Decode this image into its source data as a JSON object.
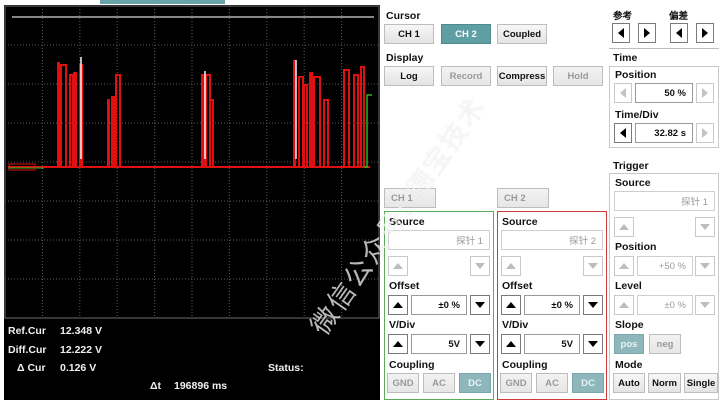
{
  "scope": {
    "readouts": {
      "ref_label": "Ref.Cur",
      "ref_value": "12.348 V",
      "diff_label": "Diff.Cur",
      "diff_value": "12.222 V",
      "delta_label": "Δ Cur",
      "delta_value": "0.126 V",
      "status_label": "Status:",
      "dt_label": "Δt",
      "dt_value": "196896 ms"
    }
  },
  "cursor": {
    "title": "Cursor",
    "buttons": [
      "CH 1",
      "CH 2",
      "Coupled"
    ],
    "active": "CH 2"
  },
  "display": {
    "title": "Display",
    "buttons": [
      "Log",
      "Record",
      "Compress",
      "Hold"
    ]
  },
  "ref": {
    "label_ref": "参考",
    "label_diff": "偏差"
  },
  "time": {
    "title": "Time",
    "position_label": "Position",
    "position_value": "50 %",
    "timediv_label": "Time/Div",
    "timediv_value": "32.82 s"
  },
  "trigger": {
    "title": "Trigger",
    "source_label": "Source",
    "source_value": "探针 1",
    "position_label": "Position",
    "position_value": "+50 %",
    "level_label": "Level",
    "level_value": "±0 %",
    "slope_label": "Slope",
    "slope_buttons": [
      "pos",
      "neg"
    ],
    "mode_label": "Mode",
    "mode_buttons": [
      "Auto",
      "Norm",
      "Single"
    ]
  },
  "ch1": {
    "tab": "CH 1",
    "source_label": "Source",
    "source_value": "探针 1",
    "offset_label": "Offset",
    "offset_value": "±0 %",
    "vdiv_label": "V/Div",
    "vdiv_value": "5V",
    "coupling_label": "Coupling",
    "coupling_buttons": [
      "GND",
      "AC",
      "DC"
    ],
    "border_color": "#5aab5a"
  },
  "ch2": {
    "tab": "CH 2",
    "source_label": "Source",
    "source_value": "探针 2",
    "offset_label": "Offset",
    "offset_value": "±0 %",
    "vdiv_label": "V/Div",
    "vdiv_value": "5V",
    "coupling_label": "Coupling",
    "coupling_buttons": [
      "GND",
      "AC",
      "DC"
    ],
    "border_color": "#d23b3b"
  },
  "watermark": "微信公众号: 德宝技术",
  "colors": {
    "accent": "#5f9ea3",
    "trace_red": "#e01010",
    "trace_green": "#22bb22"
  }
}
